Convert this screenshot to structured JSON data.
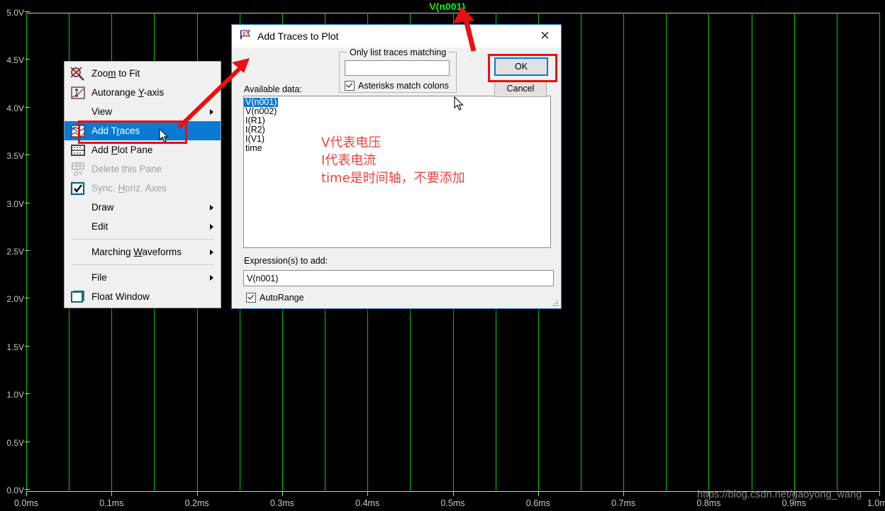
{
  "chart_data": {
    "type": "line",
    "title": "V(n001)",
    "xlabel": "",
    "ylabel": "",
    "x_ticks": [
      "0.0ms",
      "0.1ms",
      "0.2ms",
      "0.3ms",
      "0.4ms",
      "0.5ms",
      "0.6ms",
      "0.7ms",
      "0.8ms",
      "0.9ms",
      "1.0ms"
    ],
    "y_ticks": [
      "5.0V",
      "4.5V",
      "4.0V",
      "3.5V",
      "3.0V",
      "2.5V",
      "2.0V",
      "1.5V",
      "1.0V",
      "0.5V",
      "0.0V"
    ],
    "xlim": [
      0,
      1.0
    ],
    "ylim": [
      0.0,
      5.0
    ],
    "grid": true,
    "grid_color": "#00d000",
    "background": "#000000",
    "trace_color": "#00ff00",
    "series": [
      {
        "name": "V(n001)",
        "values": []
      }
    ],
    "legend_position": "top-center",
    "note": "No trace plotted yet; empty black plot pane with green grid."
  },
  "plot": {
    "trace_label": "V(n001)",
    "watermark": "https://blog.csdn.net/gaoyong_wang"
  },
  "context_menu": {
    "items": [
      {
        "label": "Zoom to Fit",
        "icon": "zoom-to-fit-icon",
        "type": "item",
        "state": "normal"
      },
      {
        "label": "Autorange Y-axis",
        "icon": "autorange-y-icon",
        "type": "item",
        "state": "normal"
      },
      {
        "label": "View",
        "icon": "none",
        "type": "submenu",
        "state": "normal"
      },
      {
        "label": "Add Traces",
        "icon": "add-traces-icon",
        "type": "item",
        "state": "selected"
      },
      {
        "label": "Add Plot Pane",
        "icon": "add-plot-pane-icon",
        "type": "item",
        "state": "normal"
      },
      {
        "label": "Delete this Pane",
        "icon": "delete-pane-icon",
        "type": "item",
        "state": "disabled"
      },
      {
        "label": "Sync. Horiz. Axes",
        "icon": "checkbox-checked-icon",
        "type": "item",
        "state": "disabled"
      },
      {
        "label": "Draw",
        "icon": "none",
        "type": "submenu",
        "state": "normal"
      },
      {
        "label": "Edit",
        "icon": "none",
        "type": "submenu",
        "state": "normal"
      },
      {
        "label": "Marching Waveforms",
        "icon": "none",
        "type": "submenu",
        "state": "normal"
      },
      {
        "label": "File",
        "icon": "none",
        "type": "submenu",
        "state": "normal"
      },
      {
        "label": "Float Window",
        "icon": "float-window-icon",
        "type": "item",
        "state": "normal"
      }
    ]
  },
  "dialog": {
    "title": "Add Traces to Plot",
    "title_icon": "ltspice-flag-icon",
    "close_icon": "close-icon",
    "group_legend": "Only list traces matching",
    "match_value": "",
    "asterisks_label": "Asterisks match colons",
    "asterisks_checked": true,
    "available_label": "Available data:",
    "available_items": [
      {
        "label": "V(n001)",
        "selected": true
      },
      {
        "label": "V(n002)",
        "selected": false
      },
      {
        "label": "I(R1)",
        "selected": false
      },
      {
        "label": "I(R2)",
        "selected": false
      },
      {
        "label": "I(V1)",
        "selected": false
      },
      {
        "label": "time",
        "selected": false
      }
    ],
    "expression_label": "Expression(s) to add:",
    "expression_value": "V(n001)",
    "autorange_label": "AutoRange",
    "autorange_checked": true,
    "ok_label": "OK",
    "cancel_label": "Cancel"
  },
  "annotation": {
    "note_line1": "V代表电压",
    "note_line2": "I代表电流",
    "note_line3": "time是时间轴，不要添加",
    "note_color": "#f04040",
    "highlight_color": "#e81010"
  }
}
